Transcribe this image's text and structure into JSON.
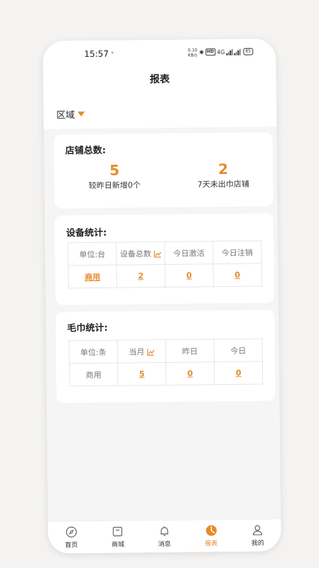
{
  "status": {
    "time": "15:57",
    "speed_top": "0.10",
    "speed_unit": "KB/s",
    "hd": "HD",
    "net": "4G",
    "battery": "85"
  },
  "header": {
    "title": "报表"
  },
  "filter": {
    "region_label": "区域"
  },
  "stores": {
    "title": "店铺总数:",
    "stats": [
      {
        "value": "5",
        "label": "较昨日新增0个"
      },
      {
        "value": "2",
        "label": "7天未出巾店铺"
      }
    ]
  },
  "devices": {
    "title": "设备统计:",
    "headers": [
      "单位:台",
      "设备总数",
      "今日激活",
      "今日注销"
    ],
    "row": {
      "label": "商用",
      "values": [
        "2",
        "0",
        "0"
      ]
    }
  },
  "towels": {
    "title": "毛巾统计:",
    "headers": [
      "单位:条",
      "当月",
      "昨日",
      "今日"
    ],
    "row": {
      "label": "商用",
      "values": [
        "5",
        "0",
        "0"
      ]
    }
  },
  "tabbar": {
    "items": [
      {
        "label": "首页",
        "icon": "compass-icon"
      },
      {
        "label": "商城",
        "icon": "shopping-bag-icon"
      },
      {
        "label": "消息",
        "icon": "bell-icon"
      },
      {
        "label": "报表",
        "icon": "pie-chart-icon",
        "active": true
      },
      {
        "label": "我的",
        "icon": "user-icon"
      }
    ]
  },
  "colors": {
    "accent": "#e58b2a",
    "background": "#f5f5f5",
    "card": "#ffffff"
  }
}
